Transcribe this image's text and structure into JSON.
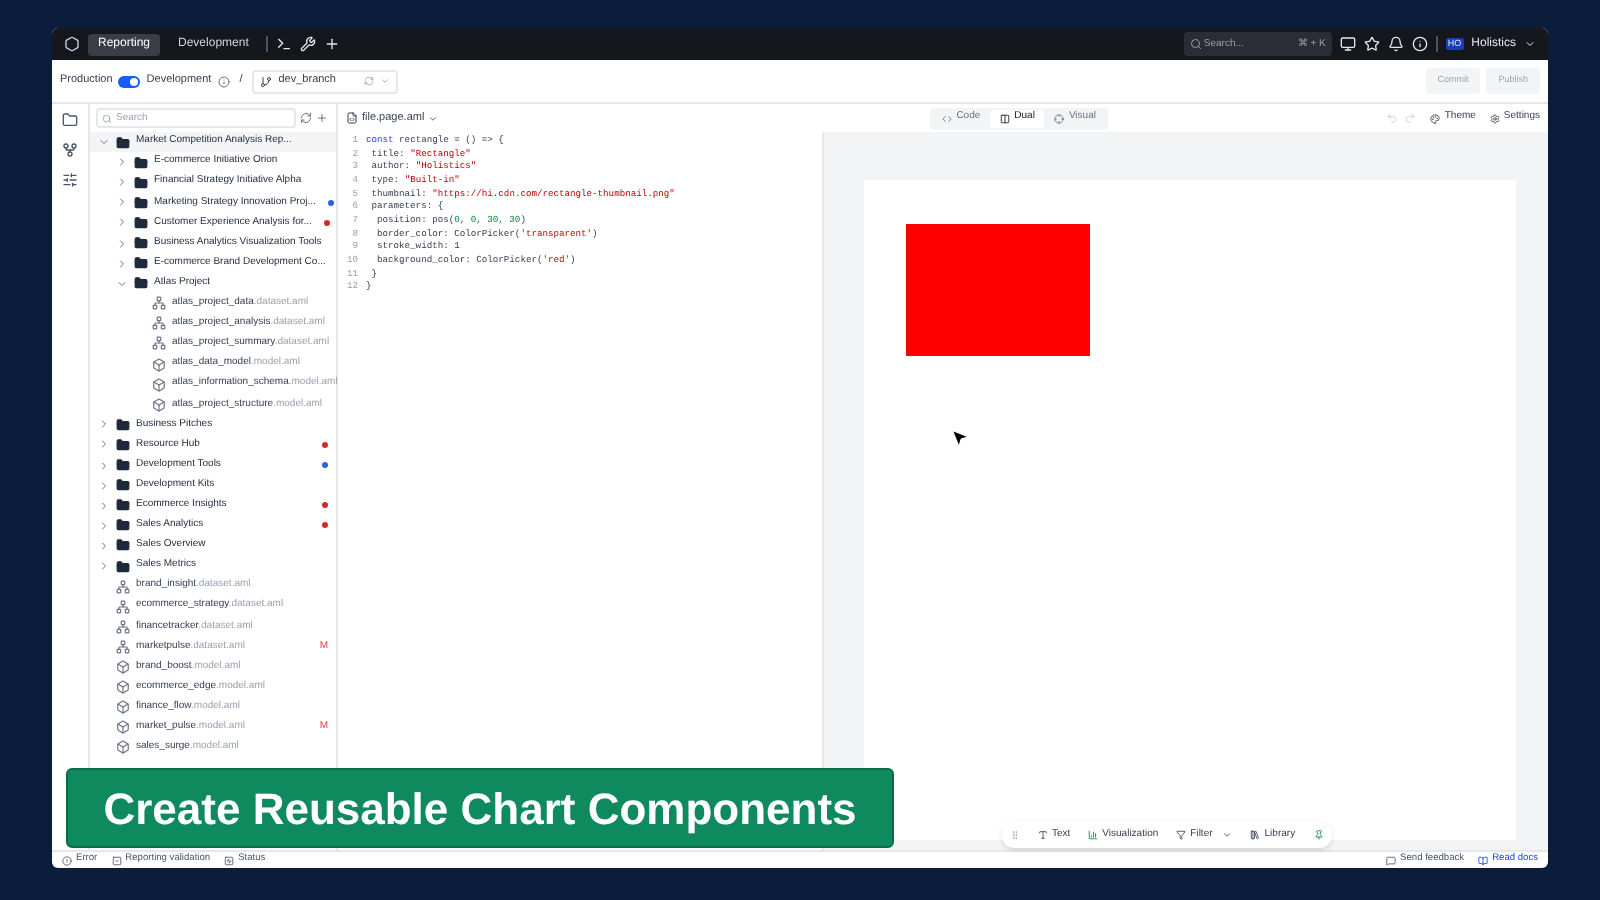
{
  "top_nav": {
    "tabs": [
      {
        "label": "Reporting",
        "selected": true
      },
      {
        "label": "Development",
        "selected": false
      }
    ],
    "search": {
      "placeholder": "Search...",
      "shortcut": "⌘ + K"
    },
    "user": {
      "initials": "HO",
      "name": "Holistics"
    }
  },
  "toolbar": {
    "env_left": "Production",
    "env_right": "Development",
    "env_on": true,
    "separator": "/",
    "branch": "dev_branch",
    "buttons": [
      {
        "label": "Commit",
        "disabled": true
      },
      {
        "label": "Publish",
        "disabled": true
      }
    ]
  },
  "sidebar": {
    "search_placeholder": "Search",
    "tree": [
      {
        "kind": "folder",
        "name": "Market Competition Analysis Rep...",
        "expanded": true,
        "children": [
          {
            "kind": "folder",
            "name": "E-commerce Initiative Orion",
            "expanded": false
          },
          {
            "kind": "folder",
            "name": "Financial Strategy Initiative Alpha",
            "expanded": false
          },
          {
            "kind": "folder",
            "name": "Marketing Strategy Innovation Proj...",
            "expanded": false,
            "color": "#2563eb"
          },
          {
            "kind": "folder",
            "name": "Customer Experience Analysis for...",
            "expanded": false,
            "color": "#dc2626"
          },
          {
            "kind": "folder",
            "name": "Business Analytics Visualization Tools",
            "expanded": false
          },
          {
            "kind": "folder",
            "name": "E-commerce Brand Development Co...",
            "expanded": false
          },
          {
            "kind": "folder",
            "name": "Atlas Project",
            "expanded": true,
            "children": [
              {
                "kind": "dataset",
                "name": "atlas_project_data",
                "ext": ".dataset.aml"
              },
              {
                "kind": "dataset",
                "name": "atlas_project_analysis",
                "ext": ".dataset.aml"
              },
              {
                "kind": "dataset",
                "name": "atlas_project_summary",
                "ext": ".dataset.aml"
              },
              {
                "kind": "model",
                "name": "atlas_data_model",
                "ext": ".model.aml"
              },
              {
                "kind": "model",
                "name": "atlas_information_schema",
                "ext": ".model.aml"
              },
              {
                "kind": "model",
                "name": "atlas_project_structure",
                "ext": ".model.aml"
              }
            ]
          }
        ]
      },
      {
        "kind": "folder",
        "name": "Business Pitches",
        "expanded": false
      },
      {
        "kind": "folder",
        "name": "Resource Hub",
        "expanded": false,
        "color": "#dc2626"
      },
      {
        "kind": "folder",
        "name": "Development Tools",
        "expanded": false,
        "color": "#2563eb"
      },
      {
        "kind": "folder",
        "name": "Development Kits",
        "expanded": false
      },
      {
        "kind": "folder",
        "name": "Ecommerce Insights",
        "expanded": false,
        "color": "#dc2626"
      },
      {
        "kind": "folder",
        "name": "Sales Analytics",
        "expanded": false,
        "color": "#dc2626"
      },
      {
        "kind": "folder",
        "name": "Sales Overview",
        "expanded": false
      },
      {
        "kind": "folder",
        "name": "Sales Metrics",
        "expanded": false
      },
      {
        "kind": "dataset",
        "name": "brand_insight",
        "ext": ".dataset.aml"
      },
      {
        "kind": "dataset",
        "name": "ecommerce_strategy",
        "ext": ".dataset.aml"
      },
      {
        "kind": "dataset",
        "name": "financetracker",
        "ext": ".dataset.aml"
      },
      {
        "kind": "dataset",
        "name": "marketpulse",
        "ext": ".dataset.aml",
        "badge": "M"
      },
      {
        "kind": "model",
        "name": "brand_boost",
        "ext": ".model.aml"
      },
      {
        "kind": "model",
        "name": "ecommerce_edge",
        "ext": ".model.aml"
      },
      {
        "kind": "model",
        "name": "finance_flow",
        "ext": ".model.aml"
      },
      {
        "kind": "model",
        "name": "market_pulse",
        "ext": ".model.aml",
        "badge": "M"
      },
      {
        "kind": "model",
        "name": "sales_surge",
        "ext": ".model.aml"
      }
    ]
  },
  "editor": {
    "file": "file.page.aml",
    "view_modes": [
      {
        "label": "Code",
        "selected": false
      },
      {
        "label": "Dual",
        "selected": true
      },
      {
        "label": "Visual",
        "selected": false
      }
    ],
    "actions": [
      "Theme",
      "Settings"
    ],
    "lines": [
      {
        "number": "1",
        "tokens": [
          {
            "text": "const",
            "kind": "keyword"
          },
          {
            "text": " rectangle = () => {",
            "kind": "plain"
          }
        ]
      },
      {
        "number": "2",
        "tokens": [
          {
            "text": " title: ",
            "kind": "plain"
          },
          {
            "text": "\"Rectangle\"",
            "kind": "string"
          }
        ]
      },
      {
        "number": "3",
        "tokens": [
          {
            "text": " author: ",
            "kind": "plain"
          },
          {
            "text": "\"Holistics\"",
            "kind": "string"
          }
        ]
      },
      {
        "number": "4",
        "tokens": [
          {
            "text": " type: ",
            "kind": "plain"
          },
          {
            "text": "\"Built-in\"",
            "kind": "string"
          }
        ]
      },
      {
        "number": "5",
        "tokens": [
          {
            "text": " thumbnail: ",
            "kind": "plain"
          },
          {
            "text": "\"https://hi.cdn.com/rectangle-thumbnail.png\"",
            "kind": "string"
          }
        ]
      },
      {
        "number": "6",
        "tokens": [
          {
            "text": " parameters: {",
            "kind": "plain"
          }
        ]
      },
      {
        "number": "7",
        "tokens": [
          {
            "text": "  position: pos(",
            "kind": "plain"
          },
          {
            "text": "0, 0, 30, 30",
            "kind": "number"
          },
          {
            "text": ")",
            "kind": "plain"
          }
        ]
      },
      {
        "number": "8",
        "tokens": [
          {
            "text": "  border_color: ColorPicker(",
            "kind": "plain"
          },
          {
            "text": "'transparent'",
            "kind": "string"
          },
          {
            "text": ")",
            "kind": "plain"
          }
        ]
      },
      {
        "number": "9",
        "tokens": [
          {
            "text": "  stroke_width: 1",
            "kind": "plain"
          }
        ]
      },
      {
        "number": "10",
        "tokens": [
          {
            "text": "  background_color: ColorPicker(",
            "kind": "plain"
          },
          {
            "text": "'red'",
            "kind": "string"
          },
          {
            "text": ")",
            "kind": "plain"
          }
        ]
      },
      {
        "number": "11",
        "tokens": [
          {
            "text": " }",
            "kind": "plain"
          }
        ]
      },
      {
        "number": "12",
        "tokens": [
          {
            "text": "}",
            "kind": "plain"
          }
        ]
      }
    ]
  },
  "canvas": {
    "shape": {
      "color": "#ff0000"
    },
    "tools": [
      {
        "kind": "text",
        "label": "Text"
      },
      {
        "kind": "viz",
        "label": "Visualization"
      },
      {
        "kind": "filter",
        "label": "Filter"
      },
      {
        "kind": "library",
        "label": "Library"
      }
    ]
  },
  "status_bar": {
    "left": [
      {
        "kind": "error",
        "label": "Error"
      },
      {
        "kind": "check",
        "label": "Reporting validation"
      },
      {
        "kind": "status",
        "label": "Status"
      }
    ],
    "right": [
      {
        "kind": "feedback",
        "label": "Send feedback"
      },
      {
        "kind": "docs",
        "label": "Read docs"
      }
    ]
  },
  "banner": "Create Reusable Chart Components"
}
